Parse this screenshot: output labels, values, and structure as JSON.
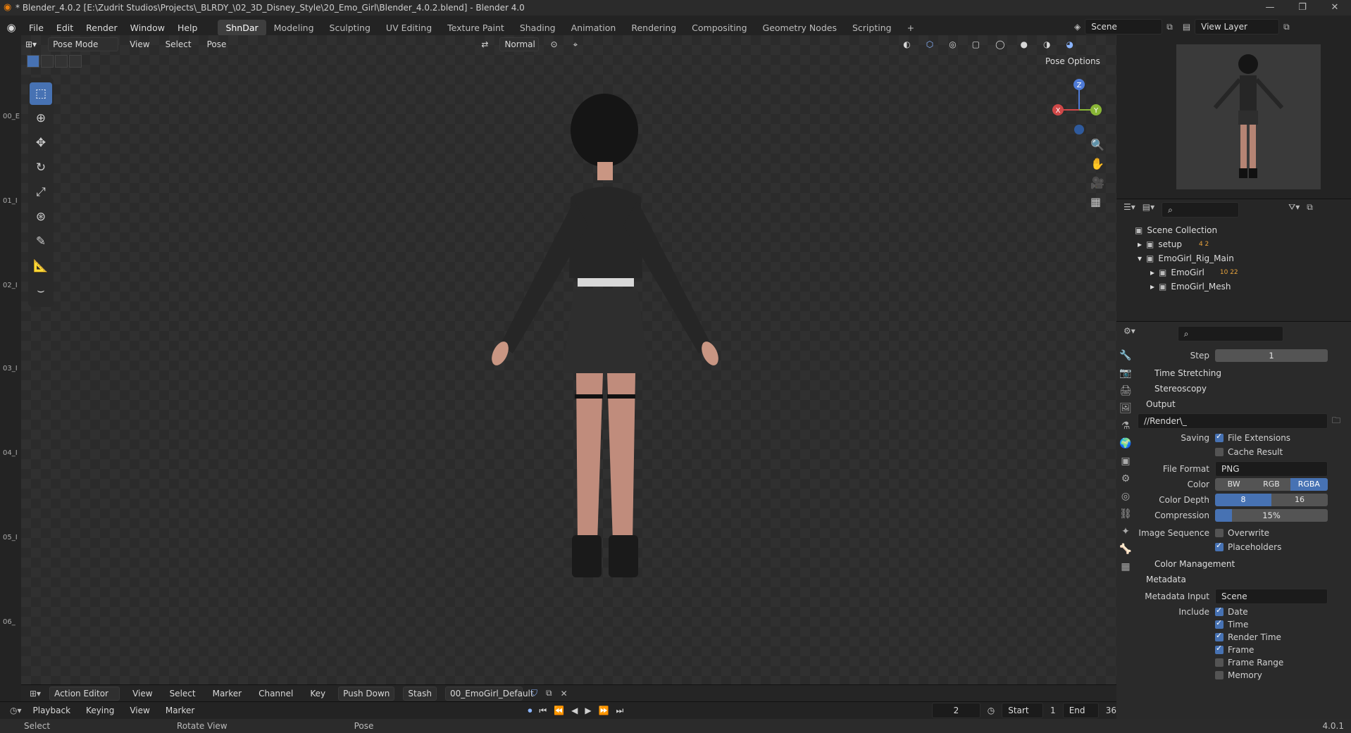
{
  "window": {
    "title": "* Blender_4.0.2 [E:\\Zudrit Studios\\Projects\\_BLRDY_\\02_3D_Disney_Style\\20_Emo_Girl\\Blender_4.0.2.blend] - Blender 4.0",
    "controls": [
      "—",
      "❐",
      "✕"
    ]
  },
  "menu": {
    "items": [
      "File",
      "Edit",
      "Render",
      "Window",
      "Help"
    ],
    "workspaces": [
      "ShnDar",
      "Modeling",
      "Sculpting",
      "UV Editing",
      "Texture Paint",
      "Shading",
      "Animation",
      "Rendering",
      "Compositing",
      "Geometry Nodes",
      "Scripting",
      "+"
    ],
    "active_workspace": "ShnDar",
    "scene": "Scene",
    "view_layer": "View Layer"
  },
  "viewport_header": {
    "mode": "Pose Mode",
    "menus": [
      "View",
      "Select",
      "Pose"
    ],
    "orientation": "Normal",
    "pose_options": "Pose Options"
  },
  "gizmo": {
    "z": "Z",
    "x": "X",
    "y": "Y"
  },
  "tracks": [
    "00_E",
    "01_I",
    "02_I",
    "03_I",
    "04_I",
    "05_I",
    "06_"
  ],
  "tools": [
    "select-box",
    "cursor",
    "move",
    "rotate",
    "scale",
    "transform",
    "annotate",
    "measure",
    "bone-relax"
  ],
  "nav_icons": [
    "zoom-icon",
    "hand-icon",
    "camera-icon",
    "grid-icon"
  ],
  "timeline_header": {
    "editor": "Action Editor",
    "menus": [
      "View",
      "Select",
      "Marker",
      "Channel",
      "Key"
    ],
    "push_down": "Push Down",
    "stash": "Stash",
    "action": "00_EmoGirl_Default"
  },
  "timeline_controls": {
    "playback": "Playback",
    "keying": "Keying",
    "view": "View",
    "marker": "Marker",
    "current_frame": "2",
    "start_label": "Start",
    "start": "1",
    "end_label": "End",
    "end": "36"
  },
  "status": {
    "select": "Select",
    "rotate": "Rotate View",
    "pose": "Pose",
    "version": "4.0.1"
  },
  "outliner": {
    "root": "Scene Collection",
    "rows": [
      {
        "name": "setup",
        "badge": "4 2"
      },
      {
        "name": "EmoGirl_Rig_Main",
        "badge": ""
      },
      {
        "name": "EmoGirl",
        "badge": "10 22"
      },
      {
        "name": "EmoGirl_Mesh",
        "badge": ""
      }
    ]
  },
  "properties": {
    "step_label": "Step",
    "step": "1",
    "time_stretching": "Time Stretching",
    "stereoscopy": "Stereoscopy",
    "output": "Output",
    "path": "//Render\\_",
    "saving": "Saving",
    "file_extensions": "File Extensions",
    "cache_result": "Cache Result",
    "file_format_label": "File Format",
    "file_format": "PNG",
    "color_label": "Color",
    "color_options": [
      "BW",
      "RGB",
      "RGBA"
    ],
    "color_selected": "RGBA",
    "color_depth_label": "Color Depth",
    "color_depth_options": [
      "8",
      "16"
    ],
    "color_depth_selected": "8",
    "compression_label": "Compression",
    "compression": "15%",
    "compression_value": 0.15,
    "image_sequence": "Image Sequence",
    "overwrite": "Overwrite",
    "placeholders": "Placeholders",
    "color_management": "Color Management",
    "metadata": "Metadata",
    "metadata_input_label": "Metadata Input",
    "metadata_input": "Scene",
    "include_label": "Include",
    "include_items": [
      {
        "label": "Date",
        "checked": true
      },
      {
        "label": "Time",
        "checked": true
      },
      {
        "label": "Render Time",
        "checked": true
      },
      {
        "label": "Frame",
        "checked": true
      },
      {
        "label": "Frame Range",
        "checked": false
      },
      {
        "label": "Memory",
        "checked": false
      }
    ]
  },
  "colors": {
    "accent": "#4772b3",
    "panel": "#2a2a2a",
    "background": "#1d1d1d"
  }
}
